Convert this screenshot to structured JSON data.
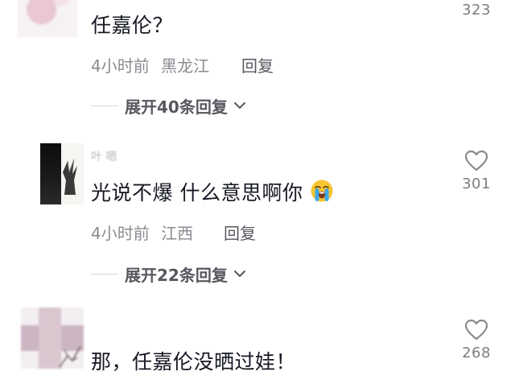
{
  "comments": [
    {
      "text": "任嘉伦？",
      "time": "4小时前",
      "location": "黑龙江",
      "reply_label": "回复",
      "expand_label": "展开40条回复",
      "likes": "323"
    },
    {
      "username": "叶 嗯",
      "text": "光说不爆 什么意思啊你",
      "emoji": "loudly-crying-face",
      "time": "4小时前",
      "location": "江西",
      "reply_label": "回复",
      "expand_label": "展开22条回复",
      "likes": "301"
    },
    {
      "text": "那，任嘉伦没晒过娃！",
      "likes": "268"
    }
  ],
  "colors": {
    "text": "#161823",
    "meta": "#8a8b91",
    "secondary": "#57585f",
    "divider": "#d6d7da"
  }
}
